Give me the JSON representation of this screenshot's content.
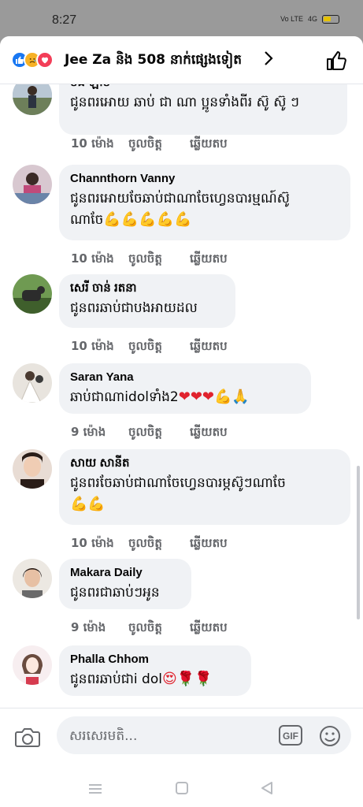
{
  "status": {
    "time": "8:27",
    "signal_top": "Vo LTE",
    "network": "4G"
  },
  "header": {
    "title": "Jee Za និង 508 នាក់ផ្សេងទៀត"
  },
  "comments": [
    {
      "author": "មីង ឡាប",
      "text": "ជូនពរអោយ ឆាប់ ជា ណា ប្អូនទាំងពីរ ស៊ូ ស៊ូ ៗ",
      "time": "10 ម៉ោង",
      "like": "ចូលចិត្ត",
      "reply": "ឆ្លើយតប"
    },
    {
      "author": "Channthorn Vanny",
      "text_line1": "ជូនពរអោយចែឆាប់ជាណាចែហ្វេនបារម្មណ៍ស៊ូ",
      "text_line2": "ណាចែ",
      "emojis": "💪💪💪💪💪",
      "time": "10 ម៉ោង",
      "like": "ចូលចិត្ត",
      "reply": "ឆ្លើយតប"
    },
    {
      "author": "សេរី ចាន់ រតនា",
      "text": "ជូនពរឆាប់ជាបងអាយដល",
      "time": "10 ម៉ោង",
      "like": "ចូលចិត្ត",
      "reply": "ឆ្លើយតប"
    },
    {
      "author": "Saran Yana",
      "text": "ឆាប់ជាណាidolទាំង2",
      "emojis": "❤❤❤💪🙏",
      "time": "9 ម៉ោង",
      "like": "ចូលចិត្ត",
      "reply": "ឆ្លើយតប"
    },
    {
      "author": "សាយ សានីត",
      "text_line1": "ជូនពរចែឆាប់ជាណាចែហ្វេនបារម្ភស៊ូៗណាចែ",
      "emojis": "💪💪",
      "time": "10 ម៉ោង",
      "like": "ចូលចិត្ត",
      "reply": "ឆ្លើយតប"
    },
    {
      "author": "Makara Daily",
      "text": "ជូនពរជាឆាប់ៗអូន",
      "time": "9 ម៉ោង",
      "like": "ចូលចិត្ត",
      "reply": "ឆ្លើយតប"
    },
    {
      "author": "Phalla Chhom",
      "text": "ជូនពរឆាប់ជាi dol",
      "emojis": "😍🌹🌹",
      "time": "9 ម៉ោង",
      "like": "ចូលចិត្ត",
      "reply": "ឆ្លើយតប"
    }
  ],
  "composer": {
    "placeholder": "សរសេរមតិ...",
    "gif_label": "GIF"
  },
  "colors": {
    "accent": "#1877f2",
    "bubble": "#f0f2f5",
    "meta": "#65676b"
  }
}
